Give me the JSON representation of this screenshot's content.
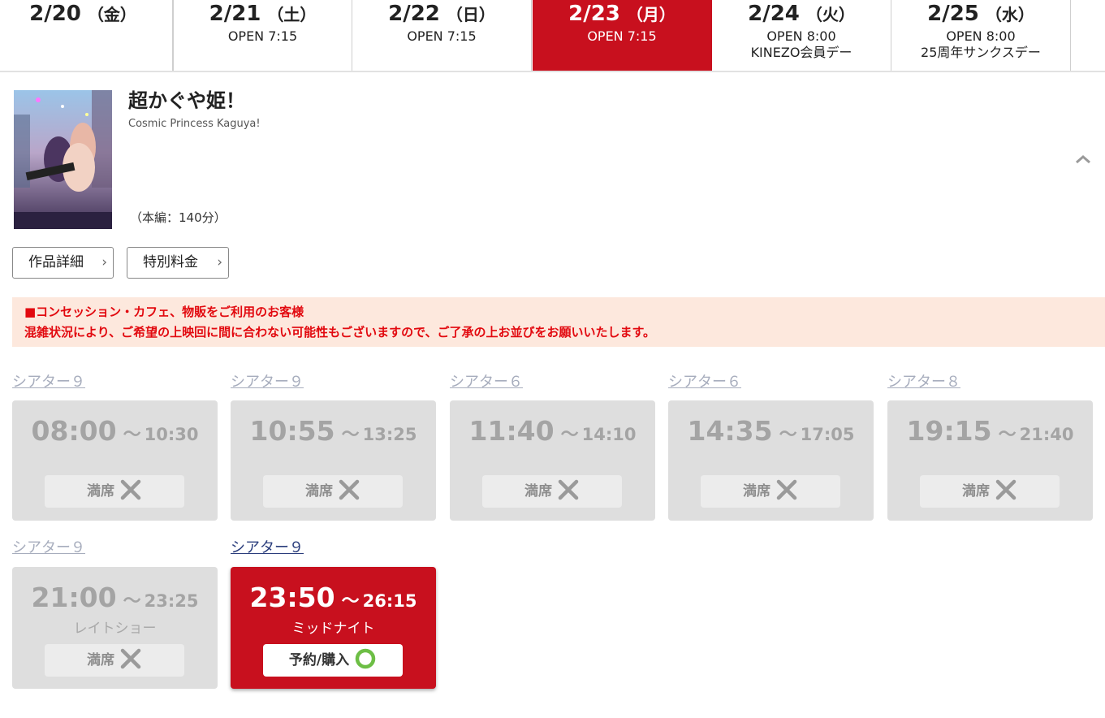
{
  "date_tabs": [
    {
      "date": "2/20",
      "weekday": "（金）",
      "line1": "",
      "line2": "",
      "active": false
    },
    {
      "date": "2/21",
      "weekday": "（土）",
      "line1": "OPEN 7:15",
      "line2": "",
      "active": false
    },
    {
      "date": "2/22",
      "weekday": "（日）",
      "line1": "OPEN 7:15",
      "line2": "",
      "active": false
    },
    {
      "date": "2/23",
      "weekday": "（月）",
      "line1": "OPEN 7:15",
      "line2": "",
      "active": true
    },
    {
      "date": "2/24",
      "weekday": "（火）",
      "line1": "OPEN 8:00",
      "line2": "KINEZO会員デー",
      "active": false
    },
    {
      "date": "2/25",
      "weekday": "（水）",
      "line1": "OPEN 8:00",
      "line2": "25周年サンクスデー",
      "active": false
    }
  ],
  "movie": {
    "title": "超かぐや姫！",
    "subtitle": "Cosmic Princess Kaguya!",
    "runtime": "（本編：140分）",
    "poster_title": "超かぐや姫!"
  },
  "buttons": {
    "details": "作品詳細",
    "special_price": "特別料金",
    "chevron": "›"
  },
  "notice": {
    "line1": "■コンセッション・カフェ、物販をご利用のお客様",
    "line2": "混雑状況により、ご希望の上映回に間に合わない可能性もございますので、ご了承の上お並びをお願いいたします。"
  },
  "showtimes": [
    {
      "theater": "シアター９",
      "start": "08:00",
      "sep": "～",
      "end": "10:30",
      "tag": "",
      "status": "満席",
      "available": false
    },
    {
      "theater": "シアター９",
      "start": "10:55",
      "sep": "～",
      "end": "13:25",
      "tag": "",
      "status": "満席",
      "available": false
    },
    {
      "theater": "シアター６",
      "start": "11:40",
      "sep": "～",
      "end": "14:10",
      "tag": "",
      "status": "満席",
      "available": false
    },
    {
      "theater": "シアター６",
      "start": "14:35",
      "sep": "～",
      "end": "17:05",
      "tag": "",
      "status": "満席",
      "available": false
    },
    {
      "theater": "シアター８",
      "start": "19:15",
      "sep": "～",
      "end": "21:40",
      "tag": "",
      "status": "満席",
      "available": false
    },
    {
      "theater": "シアター９",
      "start": "21:00",
      "sep": "～",
      "end": "23:25",
      "tag": "レイトショー",
      "status": "満席",
      "available": false
    },
    {
      "theater": "シアター９",
      "start": "23:50",
      "sep": "～",
      "end": "26:15",
      "tag": "ミッドナイト",
      "status": "予約/購入",
      "available": true
    }
  ],
  "icons": {
    "sold_out": "x-mark-icon",
    "available": "circle-icon",
    "collapse": "chevron-up-icon"
  },
  "colors": {
    "accent": "#c8101e",
    "sold_out_bg": "#dedede",
    "notice_bg": "#fde8dd",
    "notice_text": "#e2090f",
    "available_ring": "#6dbe45",
    "theater_link_active": "#2a3d7c",
    "theater_link_inactive": "#a7adbd"
  }
}
